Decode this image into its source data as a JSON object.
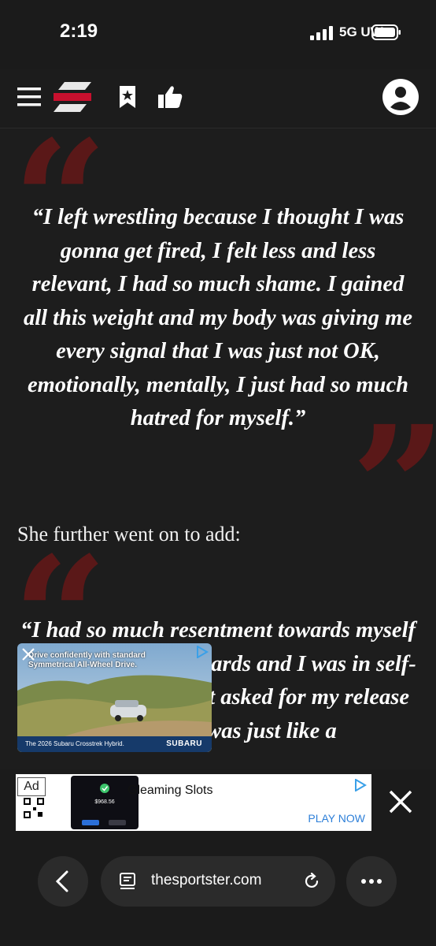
{
  "status_bar": {
    "time": "2:19",
    "network": "5G UW"
  },
  "header": {
    "logo": "TheSportster S logo"
  },
  "article": {
    "quote_1": "“I left wrestling because I thought I was gonna get fired, I felt less and less relevant, I had so much shame. I gained all this weight and my body was giving me every signal that I was just not OK, emotionally, mentally, I just had so much hatred for myself.”",
    "paragraph_1": "She further went on to add:",
    "quote_2": "“I had so much resentment towards myself that I projected outwards and I was in self-destruct mode. I just asked for my release on a day, it was just like a"
  },
  "pip_ad": {
    "headline": "Drive confidently with standard Symmetrical All-Wheel Drive.",
    "model": "The 2026 Subaru Crosstrek Hybrid.",
    "brand": "SUBARU"
  },
  "banner_ad": {
    "ad_label": "Ad",
    "amount": "$968.56",
    "title": "Gleaming Slots",
    "cta": "PLAY NOW"
  },
  "browser": {
    "url": "thesportster.com"
  },
  "colors": {
    "accent_red": "#c8102e",
    "quote_mark": "#5a1818",
    "background": "#1d1d1d"
  },
  "icons": [
    "menu-icon",
    "bookmark-icon",
    "like-icon",
    "account-icon",
    "back-icon",
    "reload-icon",
    "more-icon"
  ]
}
